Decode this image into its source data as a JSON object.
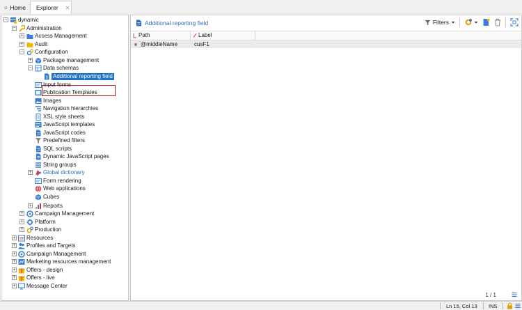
{
  "tabs": {
    "home_label": "Home",
    "explorer_label": "Explorer",
    "close_glyph": "✕"
  },
  "tree": {
    "root": "dynamic",
    "administration": "Administration",
    "access_management": "Access Management",
    "audit": "Audit",
    "configuration": "Configuration",
    "package_management": "Package management",
    "data_schemas": "Data schemas",
    "additional_reporting_field": "Additional reporting field",
    "input_forms": "Input forms",
    "publication_templates": "Publication Templates",
    "images": "Images",
    "navigation_hierarchies": "Navigation hierarchies",
    "xsl_style_sheets": "XSL style sheets",
    "javascript_templates": "JavaScript templates",
    "javascript_codes": "JavaScript codes",
    "predefined_filters": "Predefined filters",
    "sql_scripts": "SQL scripts",
    "dynamic_javascript_pages": "Dynamic JavaScript pages",
    "string_groups": "String groups",
    "global_dictionary": "Global dictionary",
    "form_rendering": "Form rendering",
    "web_applications": "Web applications",
    "cubes": "Cubes",
    "reports": "Reports",
    "campaign_management_admin": "Campaign Management",
    "platform": "Platform",
    "production": "Production",
    "resources": "Resources",
    "profiles_and_targets": "Profiles and Targets",
    "campaign_management": "Campaign Management",
    "marketing_resources_management": "Marketing resources management",
    "offers_design": "Offers - design",
    "offers_live": "Offers - live",
    "message_center": "Message Center"
  },
  "detail": {
    "title": "Additional reporting field",
    "filters_label": "Filters",
    "columns": {
      "path": "Path",
      "label": "Label"
    },
    "rows": [
      {
        "path": "@middleName",
        "label": "cusF1"
      }
    ],
    "pager": "1 / 1"
  },
  "status": {
    "position": "Ln 15, Col 13",
    "mode": "INS"
  },
  "colors": {
    "accent": "#1e73c8",
    "selection_outline": "#b0151b",
    "title_blue": "#2f6fba",
    "folder_yellow": "#f2b705"
  }
}
